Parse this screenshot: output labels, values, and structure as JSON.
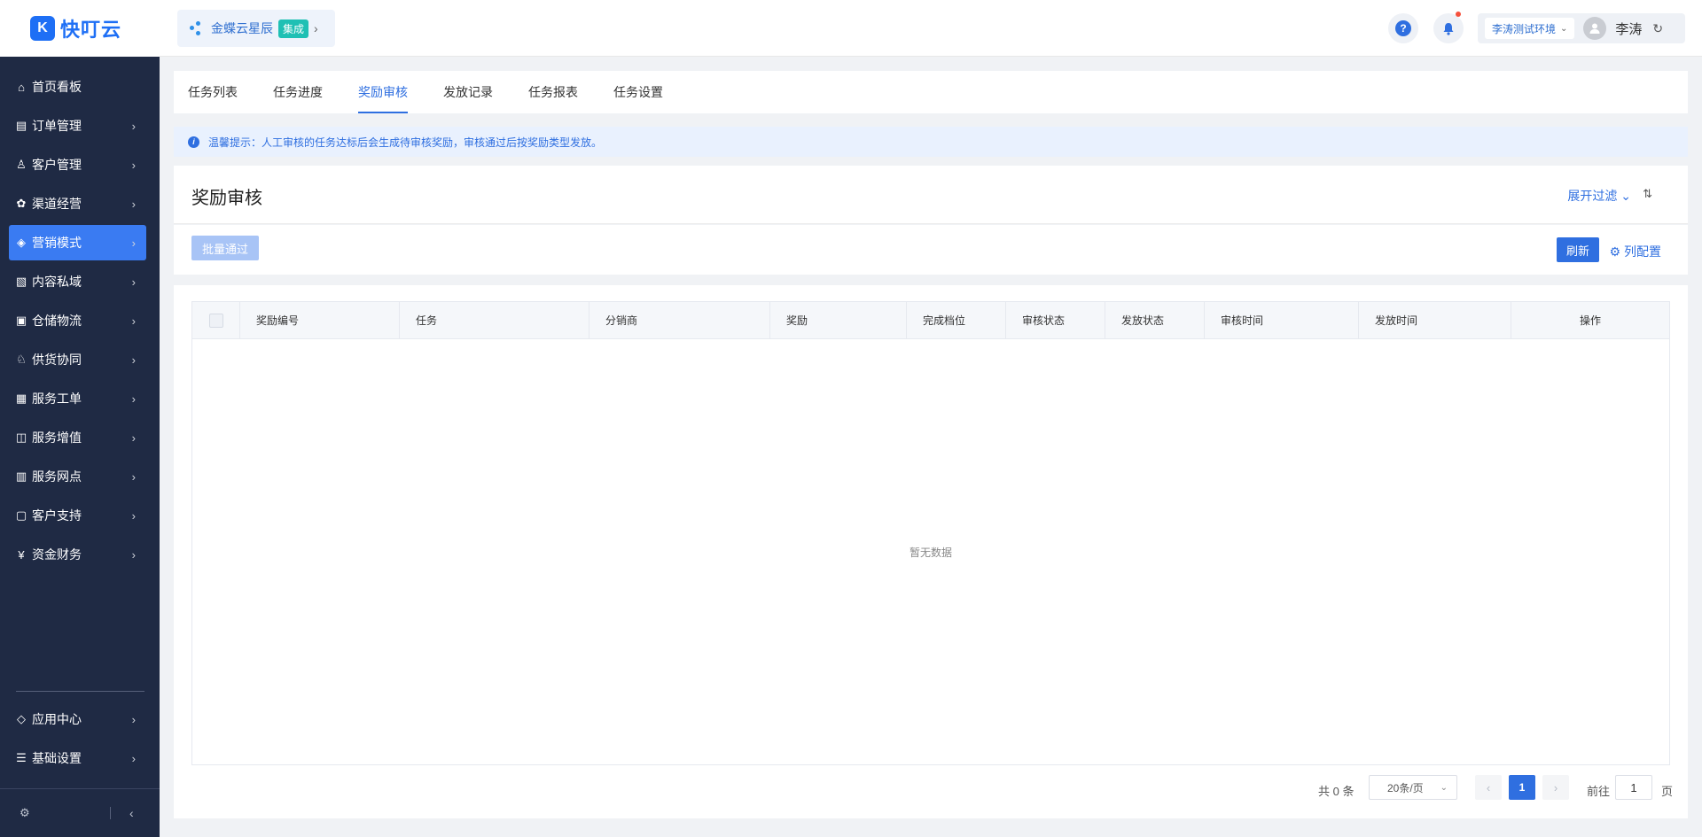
{
  "brand": {
    "logo_glyph": "K",
    "name": "快叮云"
  },
  "product": {
    "name": "金蝶云星辰",
    "badge": "集成",
    "chevron": "›"
  },
  "header": {
    "help_glyph": "?",
    "bell_glyph": "🔔",
    "env": "李涛测试环境",
    "env_caret": "⌄",
    "user_name": "李涛",
    "refresh_glyph": "↻"
  },
  "sidebar": {
    "items": [
      {
        "label": "首页看板",
        "icon": "home-icon",
        "glyph": "⌂",
        "arrow": ""
      },
      {
        "label": "订单管理",
        "icon": "order-icon",
        "glyph": "▤",
        "arrow": "›"
      },
      {
        "label": "客户管理",
        "icon": "customer-icon",
        "glyph": "♙",
        "arrow": "›"
      },
      {
        "label": "渠道经营",
        "icon": "channel-icon",
        "glyph": "✿",
        "arrow": "›"
      },
      {
        "label": "营销模式",
        "icon": "tag-icon",
        "glyph": "◈",
        "arrow": "›"
      },
      {
        "label": "内容私域",
        "icon": "image-icon",
        "glyph": "▧",
        "arrow": "›"
      },
      {
        "label": "仓储物流",
        "icon": "warehouse-icon",
        "glyph": "▣",
        "arrow": "›"
      },
      {
        "label": "供货协同",
        "icon": "supply-icon",
        "glyph": "♘",
        "arrow": "›"
      },
      {
        "label": "服务工单",
        "icon": "ticket-icon",
        "glyph": "▦",
        "arrow": "›"
      },
      {
        "label": "服务增值",
        "icon": "bag-icon",
        "glyph": "◫",
        "arrow": "›"
      },
      {
        "label": "服务网点",
        "icon": "store-icon",
        "glyph": "▥",
        "arrow": "›"
      },
      {
        "label": "客户支持",
        "icon": "support-icon",
        "glyph": "▢",
        "arrow": "›"
      },
      {
        "label": "资金财务",
        "icon": "yen-icon",
        "glyph": "¥",
        "arrow": "›"
      }
    ],
    "bottom_items": [
      {
        "label": "应用中心",
        "icon": "cube-icon",
        "glyph": "◇",
        "arrow": "›"
      },
      {
        "label": "基础设置",
        "icon": "sliders-icon",
        "glyph": "☰",
        "arrow": "›"
      }
    ],
    "footer_gear": "⚙",
    "collapse_glyph": "‹"
  },
  "tabs": [
    "任务列表",
    "任务进度",
    "奖励审核",
    "发放记录",
    "任务报表",
    "任务设置"
  ],
  "tip": {
    "icon": "i",
    "text": "温馨提示：人工审核的任务达标后会生成待审核奖励，审核通过后按奖励类型发放。"
  },
  "page": {
    "title": "奖励审核",
    "expand_filter": "展开过滤",
    "expand_caret": "⌄",
    "sort_glyph": "⇅"
  },
  "actions": {
    "batch_approve": "批量通过",
    "refresh": "刷新",
    "column_config": "列配置",
    "column_config_icon": "⚙"
  },
  "table": {
    "columns": [
      "奖励编号",
      "任务",
      "分销商",
      "奖励",
      "完成档位",
      "审核状态",
      "发放状态",
      "审核时间",
      "发放时间",
      "操作"
    ],
    "empty_text": "暂无数据"
  },
  "pagination": {
    "total": "共 0 条",
    "page_size": "20条/页",
    "page_size_caret": "⌄",
    "prev": "‹",
    "current_page": "1",
    "next": "›",
    "goto_label": "前往",
    "goto_value": "1",
    "page_suffix": "页"
  },
  "colors": {
    "primary": "#2f6fe0",
    "sidebar_bg": "#1f2a44",
    "active_item": "#3a7bf2"
  }
}
